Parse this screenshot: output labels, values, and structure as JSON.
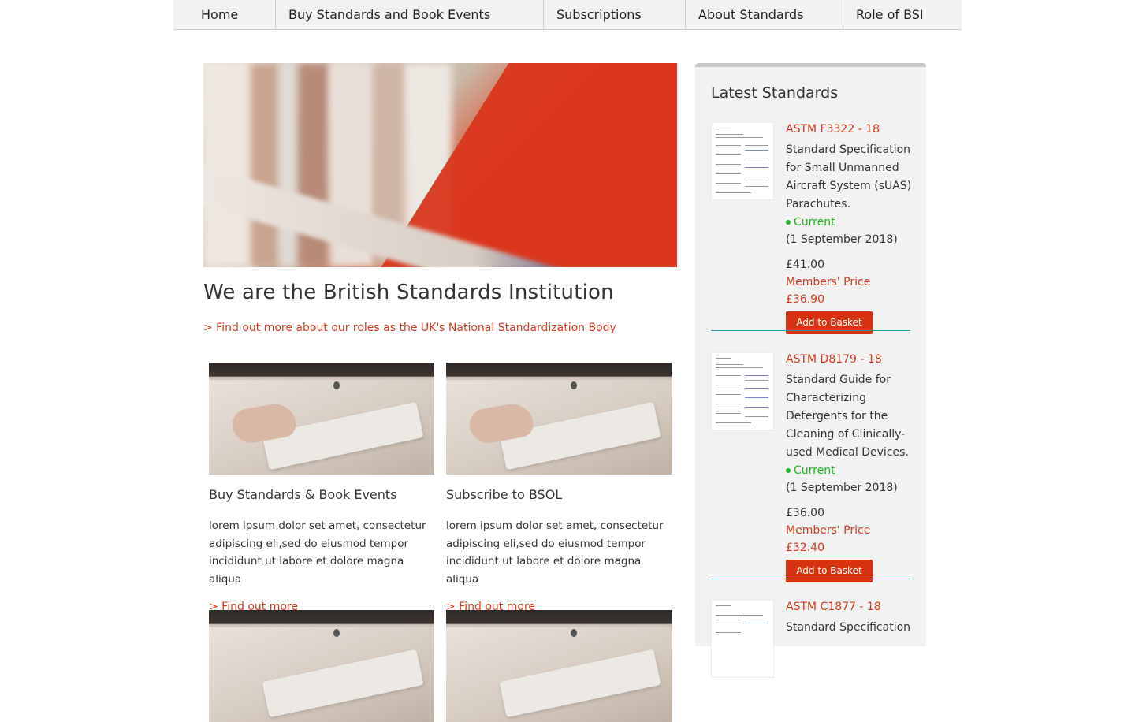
{
  "nav": {
    "items": [
      {
        "label": "Home"
      },
      {
        "label": "Buy Standards and Book Events"
      },
      {
        "label": "Subscriptions"
      },
      {
        "label": "About Standards"
      },
      {
        "label": "Role of BSI"
      }
    ]
  },
  "hero": {
    "heading": "We are the British Standards Institution",
    "link": "> Find out more about our roles as the UK's National Standardization Body"
  },
  "cards": [
    {
      "title": "Buy Standards & Book Events",
      "desc": "lorem ipsum dolor set amet, consectetur adipiscing eli,sed do eiusmod tempor incididunt ut labore et dolore magna aliqua",
      "link": "> Find out more"
    },
    {
      "title": "Subscribe to BSOL",
      "desc": "lorem ipsum dolor set amet, consectetur adipiscing eli,sed do eiusmod tempor incididunt ut labore et dolore magna aliqua",
      "link": "> Find out more"
    }
  ],
  "sidebar": {
    "title": "Latest Standards",
    "standards": [
      {
        "code": "ASTM F3322 - 18",
        "desc": "Standard Specification for Small Unmanned Aircraft System (sUAS) Parachutes.",
        "status": "Current",
        "date": "(1 September 2018)",
        "price": "£41.00",
        "member_price": "Members' Price £36.90",
        "button": "Add to Basket"
      },
      {
        "code": "ASTM D8179 - 18",
        "desc": "Standard Guide for Characterizing Detergents for the Cleaning of Clinically-used Medical Devices.",
        "status": "Current",
        "date": "(1 September 2018)",
        "price": "£36.00",
        "member_price": "Members' Price £32.40",
        "button": "Add to Basket"
      },
      {
        "code": "ASTM C1877 - 18",
        "desc": "Standard Specification"
      }
    ]
  },
  "colors": {
    "accent": "#d43a1e",
    "button": "#d6320f",
    "status_current": "#1fb51f",
    "separator": "#2b9aa6"
  }
}
